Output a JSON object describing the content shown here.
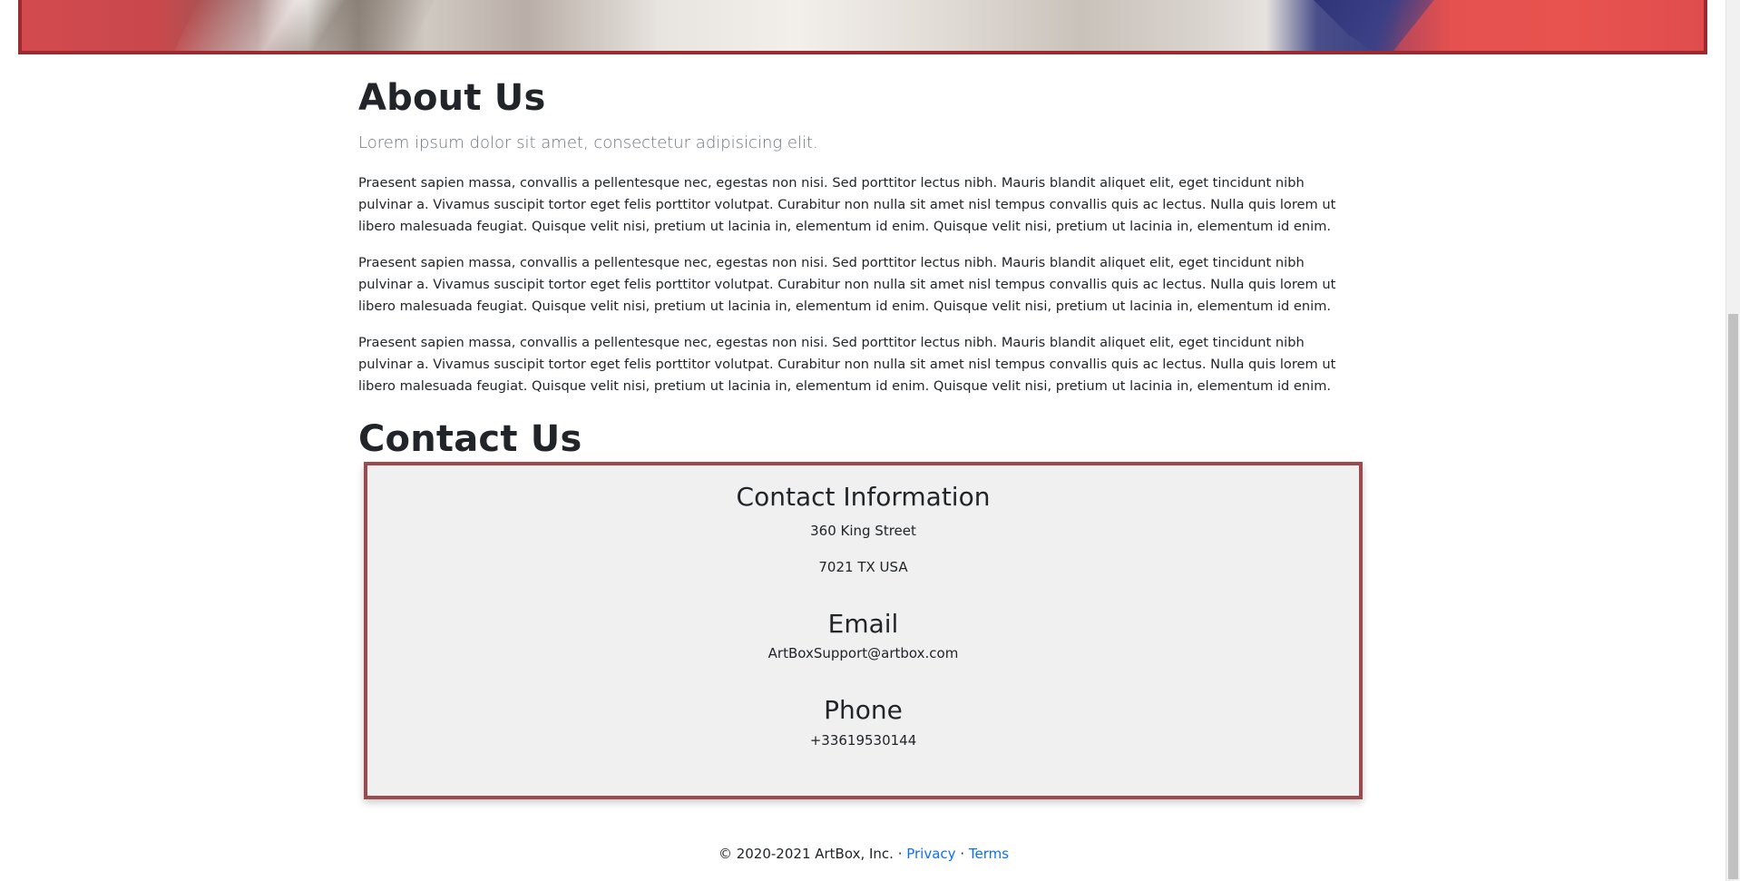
{
  "about": {
    "title": "About Us",
    "lead": "Lorem ipsum dolor sit amet, consectetur adipisicing elit.",
    "paragraphs": [
      "Praesent sapien massa, convallis a pellentesque nec, egestas non nisi. Sed porttitor lectus nibh. Mauris blandit aliquet elit, eget tincidunt nibh pulvinar a. Vivamus suscipit tortor eget felis porttitor volutpat. Curabitur non nulla sit amet nisl tempus convallis quis ac lectus. Nulla quis lorem ut libero malesuada feugiat. Quisque velit nisi, pretium ut lacinia in, elementum id enim. Quisque velit nisi, pretium ut lacinia in, elementum id enim.",
      "Praesent sapien massa, convallis a pellentesque nec, egestas non nisi. Sed porttitor lectus nibh. Mauris blandit aliquet elit, eget tincidunt nibh pulvinar a. Vivamus suscipit tortor eget felis porttitor volutpat. Curabitur non nulla sit amet nisl tempus convallis quis ac lectus. Nulla quis lorem ut libero malesuada feugiat. Quisque velit nisi, pretium ut lacinia in, elementum id enim. Quisque velit nisi, pretium ut lacinia in, elementum id enim.",
      "Praesent sapien massa, convallis a pellentesque nec, egestas non nisi. Sed porttitor lectus nibh. Mauris blandit aliquet elit, eget tincidunt nibh pulvinar a. Vivamus suscipit tortor eget felis porttitor volutpat. Curabitur non nulla sit amet nisl tempus convallis quis ac lectus. Nulla quis lorem ut libero malesuada feugiat. Quisque velit nisi, pretium ut lacinia in, elementum id enim. Quisque velit nisi, pretium ut lacinia in, elementum id enim."
    ]
  },
  "contact": {
    "title": "Contact Us",
    "info_title": "Contact Information",
    "address_line1": "360 King Street",
    "address_line2": "7021 TX USA",
    "email_title": "Email",
    "email": "ArtBoxSupport@artbox.com",
    "phone_title": "Phone",
    "phone": "+33619530144"
  },
  "footer": {
    "copyright": "© 2020-2021 ArtBox, Inc. · ",
    "privacy": "Privacy",
    "separator": " · ",
    "terms": "Terms"
  },
  "colors": {
    "accent_border": "#9b4a4d",
    "link": "#0d6efd",
    "card_bg": "#f0f0f0"
  }
}
